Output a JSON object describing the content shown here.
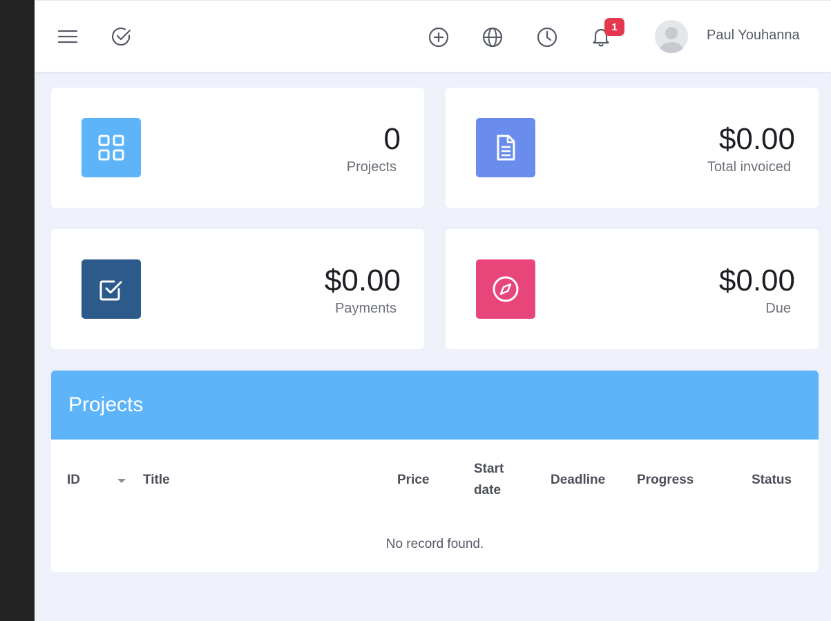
{
  "topbar": {
    "icons": [
      "menu-icon",
      "check-circle-icon",
      "plus-circle-icon",
      "globe-icon",
      "clock-icon",
      "bell-icon"
    ],
    "notification_count": "1",
    "user_name": "Paul Youhanna"
  },
  "cards": [
    {
      "value": "0",
      "label": "Projects",
      "icon": "grid-icon",
      "color": "#5db4f9"
    },
    {
      "value": "$0.00",
      "label": "Total invoiced",
      "icon": "document-icon",
      "color": "#6a8ded"
    },
    {
      "value": "$0.00",
      "label": "Payments",
      "icon": "checkbox-icon",
      "color": "#2c5a8a"
    },
    {
      "value": "$0.00",
      "label": "Due",
      "icon": "compass-icon",
      "color": "#e8467a"
    }
  ],
  "projects_panel": {
    "title": "Projects",
    "columns": [
      "ID",
      "Title",
      "Price",
      "Start date",
      "Deadline",
      "Progress",
      "Status"
    ],
    "empty_message": "No record found."
  },
  "colors": {
    "accent": "#5db4f9",
    "badge": "#e5374e",
    "background": "#eef1f9"
  }
}
